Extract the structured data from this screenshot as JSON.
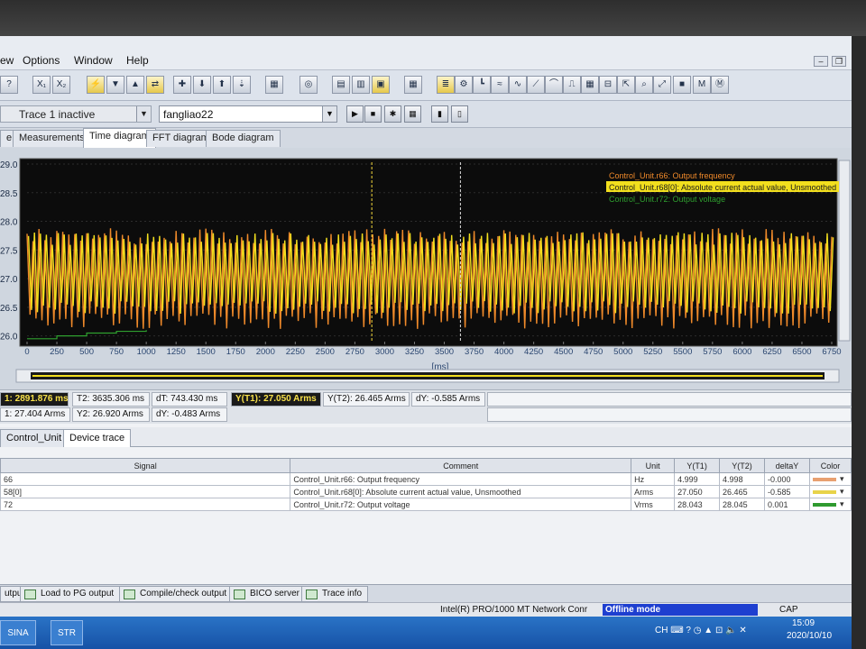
{
  "menu": {
    "items": [
      "ew",
      "Options",
      "Window",
      "Help"
    ]
  },
  "toolbar": {
    "combo_trace": "Trace 1 inactive",
    "combo_project": "fangliao22"
  },
  "tabs": [
    "e",
    "Measurements",
    "Time diagram",
    "FFT diagram",
    "Bode diagram"
  ],
  "chart_data": {
    "type": "line",
    "x_unit": "[ms]",
    "xlim": [
      0,
      6750
    ],
    "ylim": [
      25.9,
      29.0
    ],
    "x_ticks": [
      0,
      250,
      500,
      750,
      1000,
      1250,
      1500,
      1750,
      2000,
      2250,
      2500,
      2750,
      3000,
      3250,
      3500,
      3750,
      4000,
      4250,
      4500,
      4750,
      5000,
      5250,
      5500,
      5750,
      6000,
      6250,
      6500,
      6750
    ],
    "y_ticks": [
      "29.0",
      "28.5",
      "28.0",
      "27.5",
      "27.0",
      "26.5",
      "26.0"
    ],
    "y_tick_values": [
      29.0,
      28.5,
      28.0,
      27.5,
      27.0,
      26.5,
      26.0
    ],
    "cursor_t1_ms": 2891.876,
    "cursor_t2_ms": 3635.306,
    "legend": [
      "Control_Unit.r66: Output frequency",
      "Control_Unit.r68[0]: Absolute current actual value, Unsmoothed",
      "Control_Unit.r72: Output voltage"
    ],
    "series": [
      {
        "name": "Control_Unit.r66: Output frequency",
        "color": "#f08a2a",
        "style": "oscillating",
        "center": 27.0,
        "amplitude": 0.8
      },
      {
        "name": "Control_Unit.r68[0]: Absolute current actual value, Unsmoothed",
        "color": "#f2df1e",
        "style": "oscillating",
        "center": 27.1,
        "amplitude": 0.65
      },
      {
        "name": "Control_Unit.r72: Output voltage",
        "color": "#2fa02f",
        "style": "step",
        "points": [
          [
            0,
            25.95
          ],
          [
            250,
            26.0
          ],
          [
            500,
            26.05
          ],
          [
            750,
            26.08
          ],
          [
            1000,
            26.1
          ]
        ]
      }
    ]
  },
  "cursor": {
    "t1": "1: 2891.876 ms",
    "t2": "T2: 3635.306 ms",
    "dt": "dT: 743.430 ms",
    "y_t1": "Y(T1): 27.050 Arms",
    "y_t2": "Y(T2): 26.465 Arms",
    "dy": "dY: -0.585 Arms",
    "y1": "1: 27.404 Arms",
    "y2": "Y2: 26.920 Arms",
    "dy2": "dY: -0.483 Arms"
  },
  "lower_tabs": [
    "Control_Unit",
    "Device trace"
  ],
  "signal_table": {
    "headers": [
      "Signal",
      "Comment",
      "Unit",
      "Y(T1)",
      "Y(T2)",
      "deltaY",
      "Color"
    ],
    "rows": [
      {
        "signal": "66",
        "comment": "Control_Unit.r66: Output frequency",
        "unit": "Hz",
        "y1": "4.999",
        "y2": "4.998",
        "dy": "-0.000",
        "color": "#e8a070"
      },
      {
        "signal": "58[0]",
        "comment": "Control_Unit.r68[0]: Absolute current actual value, Unsmoothed",
        "unit": "Arms",
        "y1": "27.050",
        "y2": "26.465",
        "dy": "-0.585",
        "color": "#e8d34a"
      },
      {
        "signal": "72",
        "comment": "Control_Unit.r72: Output voltage",
        "unit": "Vrms",
        "y1": "28.043",
        "y2": "28.045",
        "dy": "0.001",
        "color": "#2f9a2f"
      }
    ]
  },
  "bottom_tabs": [
    "utput",
    "Load to PG output",
    "Compile/check output",
    "BICO server",
    "Trace info"
  ],
  "status": {
    "network": "Intel(R) PRO/1000 MT Network Conr",
    "mode": "Offline mode",
    "cap": "CAP"
  },
  "taskbar": {
    "time": "15:09",
    "date": "2020/10/10"
  }
}
